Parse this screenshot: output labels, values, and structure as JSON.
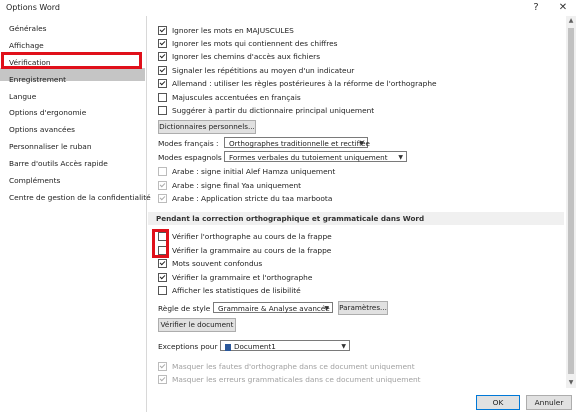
{
  "window": {
    "title": "Options Word",
    "help": "?",
    "close": "✕"
  },
  "sidebar": {
    "items": [
      {
        "label": "Générales"
      },
      {
        "label": "Affichage"
      },
      {
        "label": "Vérification"
      },
      {
        "label": "Enregistrement"
      },
      {
        "label": "Langue"
      },
      {
        "label": "Options d'ergonomie"
      },
      {
        "label": "Options avancées"
      },
      {
        "label": "Personnaliser le ruban"
      },
      {
        "label": "Barre d'outils Accès rapide"
      },
      {
        "label": "Compléments"
      },
      {
        "label": "Centre de gestion de la confidentialité"
      }
    ],
    "selected_index": 2
  },
  "autocorrect": {
    "options": [
      {
        "label": "Ignorer les mots en MAJUSCULES",
        "checked": true
      },
      {
        "label": "Ignorer les mots qui contiennent des chiffres",
        "checked": true
      },
      {
        "label": "Ignorer les chemins d'accès aux fichiers",
        "checked": true
      },
      {
        "label": "Signaler les répétitions au moyen d'un indicateur",
        "checked": true
      },
      {
        "label": "Allemand : utiliser les règles postérieures à la réforme de l'orthographe",
        "checked": true
      },
      {
        "label": "Majuscules accentuées en français",
        "checked": false
      },
      {
        "label": "Suggérer à partir du dictionnaire principal uniquement",
        "checked": false
      }
    ],
    "dictionaries_button": "Dictionnaires personnels...",
    "french_modes_label": "Modes français :",
    "french_modes_value": "Orthographes traditionnelle et rectifiée",
    "spanish_modes_label": "Modes espagnols :",
    "spanish_modes_value": "Formes verbales du tutoiement uniquement",
    "arabic": [
      {
        "label": "Arabe : signe initial Alef Hamza uniquement",
        "checked": false
      },
      {
        "label": "Arabe : signe final Yaa uniquement",
        "checked": true
      },
      {
        "label": "Arabe : Application stricte du taa marboota",
        "checked": true
      }
    ]
  },
  "grammar_section": {
    "title": "Pendant la correction orthographique et grammaticale dans Word",
    "options": [
      {
        "label": "Vérifier l'orthographe au cours de la frappe",
        "checked": false
      },
      {
        "label": "Vérifier la grammaire au cours de la frappe",
        "checked": false
      },
      {
        "label": "Mots souvent confondus",
        "checked": true
      },
      {
        "label": "Vérifier la grammaire et l'orthographe",
        "checked": true
      },
      {
        "label": "Afficher les statistiques de lisibilité",
        "checked": false
      }
    ],
    "style_rule_label": "Règle de style :",
    "style_rule_value": "Grammaire & Analyse avancée",
    "settings_button": "Paramètres...",
    "check_document_button": "Vérifier le document"
  },
  "exceptions": {
    "label": "Exceptions pour :",
    "document": "Document1",
    "options": [
      {
        "label": "Masquer les fautes d'orthographe dans ce document uniquement",
        "checked": true
      },
      {
        "label": "Masquer les erreurs grammaticales dans ce document uniquement",
        "checked": true
      }
    ]
  },
  "footer": {
    "ok": "OK",
    "cancel": "Annuler"
  },
  "colors": {
    "highlight": "#e0101a",
    "selected_bg": "#c5c5c5",
    "section_bg": "#f0f0f0"
  }
}
